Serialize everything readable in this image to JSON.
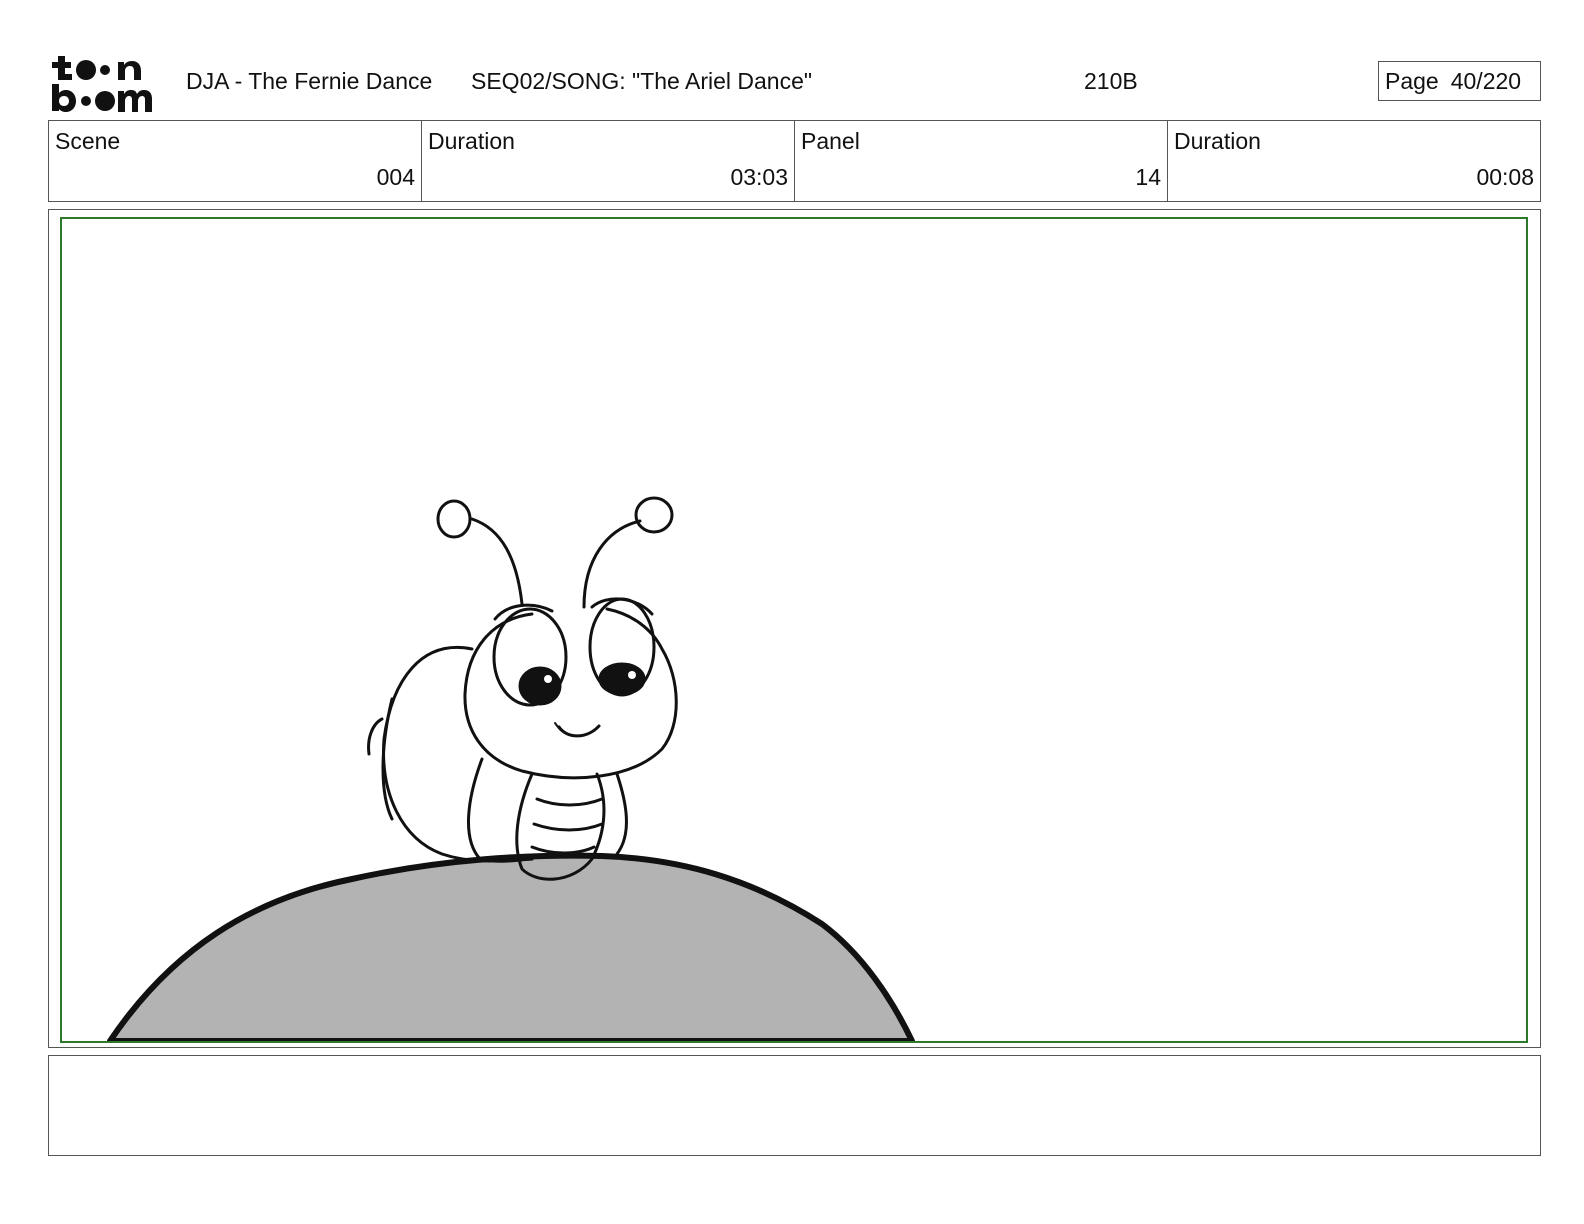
{
  "header": {
    "logo_text": "toon boom",
    "project_title": "DJA - The Fernie Dance",
    "sequence": "SEQ02/SONG: \"The Ariel Dance\"",
    "code": "210B",
    "page_label": "Page",
    "page_number": "40/220"
  },
  "info": {
    "scene_label": "Scene",
    "scene_value": "004",
    "scene_duration_label": "Duration",
    "scene_duration_value": "03:03",
    "panel_label": "Panel",
    "panel_value": "14",
    "panel_duration_label": "Duration",
    "panel_duration_value": "00:08"
  },
  "colors": {
    "frame_border": "#2c7a2c",
    "hill_fill": "#b3b3b3",
    "ink": "#111111"
  },
  "notes": {
    "text": ""
  }
}
